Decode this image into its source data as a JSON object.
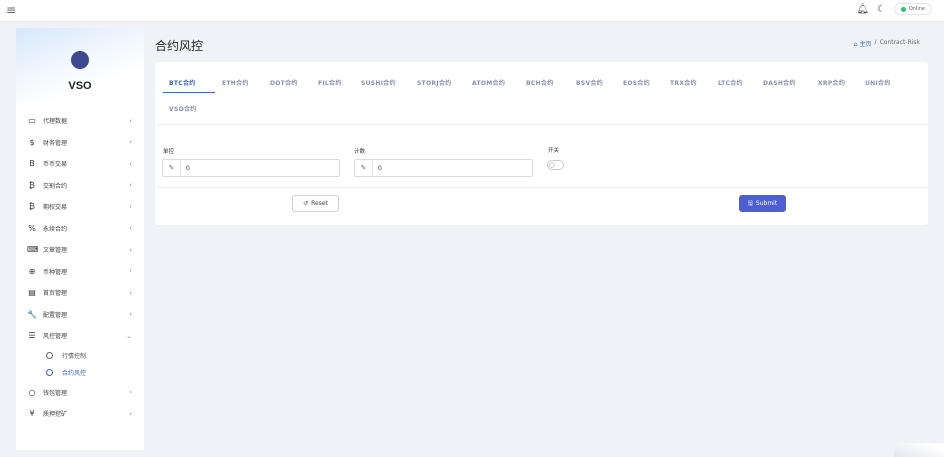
{
  "topbar": {
    "menu_icon": "hamburger-icon",
    "bell_icon": "bell-icon",
    "theme_icon": "moon-icon",
    "status_label": "Online",
    "status_color": "#28c76f"
  },
  "sidebar": {
    "brand": "VSO",
    "items": [
      {
        "label": "代理数据",
        "icon": "id-card-icon",
        "glyph": "▭"
      },
      {
        "label": "财务管理",
        "icon": "dollar-icon",
        "glyph": "$"
      },
      {
        "label": "币币交易",
        "icon": "bitcoin-b-icon",
        "glyph": "B"
      },
      {
        "label": "交割合约",
        "icon": "bitcoin-icon",
        "glyph": "₿"
      },
      {
        "label": "期权交易",
        "icon": "bitcoin-icon",
        "glyph": "₿"
      },
      {
        "label": "永续合约",
        "icon": "percent-icon",
        "glyph": "%"
      },
      {
        "label": "文章管理",
        "icon": "keyboard-icon",
        "glyph": "⌨"
      },
      {
        "label": "币种管理",
        "icon": "coin-icon",
        "glyph": "⊕"
      },
      {
        "label": "首页管理",
        "icon": "layout-icon",
        "glyph": "▤"
      },
      {
        "label": "配置管理",
        "icon": "wrench-icon",
        "glyph": "🔧"
      },
      {
        "label": "风控管理",
        "icon": "list-icon",
        "glyph": "☰",
        "expanded": true
      }
    ],
    "subitems": [
      {
        "label": "行情控制",
        "active": false
      },
      {
        "label": "合约风控",
        "active": true
      }
    ],
    "bottom_items": [
      {
        "label": "钱包管理",
        "icon": "circle-icon",
        "glyph": "○"
      },
      {
        "label": "质押挖矿",
        "icon": "yen-icon",
        "glyph": "¥"
      }
    ]
  },
  "page": {
    "title": "合约风控",
    "breadcrumb_home": "主页",
    "breadcrumb_sep": "/",
    "breadcrumb_current": "Contract-Risk"
  },
  "tabs": [
    "BTC合约",
    "ETH合约",
    "DOT合约",
    "FIL合约",
    "SUSHI合约",
    "STORJ合约",
    "ATOM合约",
    "BCH合约",
    "BSV合约",
    "EOS合约",
    "TRX合约",
    "LTC合约",
    "DASH合约",
    "XRP合约",
    "UNI合约",
    "VSO合约"
  ],
  "active_tab": 0,
  "form": {
    "field1_label": "单控",
    "field1_value": "0",
    "field2_label": "计数",
    "field2_value": "0",
    "switch_label": "开关",
    "switch_on": false,
    "reset_label": "Reset",
    "submit_label": "Submit"
  },
  "colors": {
    "accent": "#3f5fc9",
    "submit_bg": "#4e5fd3"
  }
}
